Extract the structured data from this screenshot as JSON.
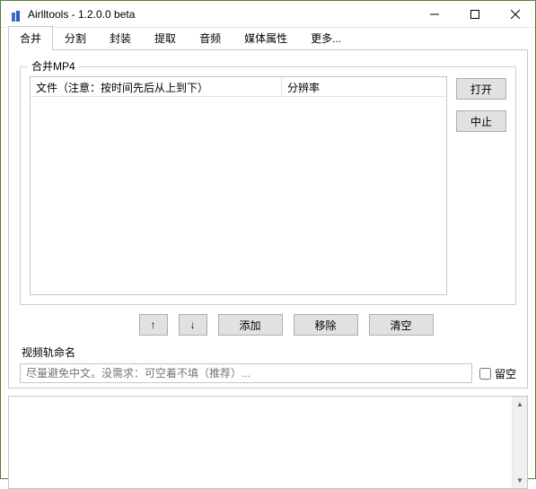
{
  "window": {
    "title": "Airlltools  -  1.2.0.0 beta"
  },
  "tabs": {
    "items": [
      {
        "label": "合并"
      },
      {
        "label": "分割"
      },
      {
        "label": "封装"
      },
      {
        "label": "提取"
      },
      {
        "label": "音频"
      },
      {
        "label": "媒体属性"
      },
      {
        "label": "更多..."
      }
    ]
  },
  "mergePanel": {
    "groupTitle": "合并MP4",
    "columns": {
      "file": "文件（注意：按时间先后从上到下）",
      "resolution": "分辨率"
    },
    "sideButtons": {
      "open": "打开",
      "stop": "中止"
    },
    "orderButtons": {
      "up": "↑",
      "down": "↓"
    },
    "actionButtons": {
      "add": "添加",
      "remove": "移除",
      "clear": "清空"
    },
    "trackLabel": "视频轨命名",
    "trackPlaceholder": "尽量避免中文。没需求：可空着不填（推荐）...",
    "emptyCheckbox": "留空"
  }
}
